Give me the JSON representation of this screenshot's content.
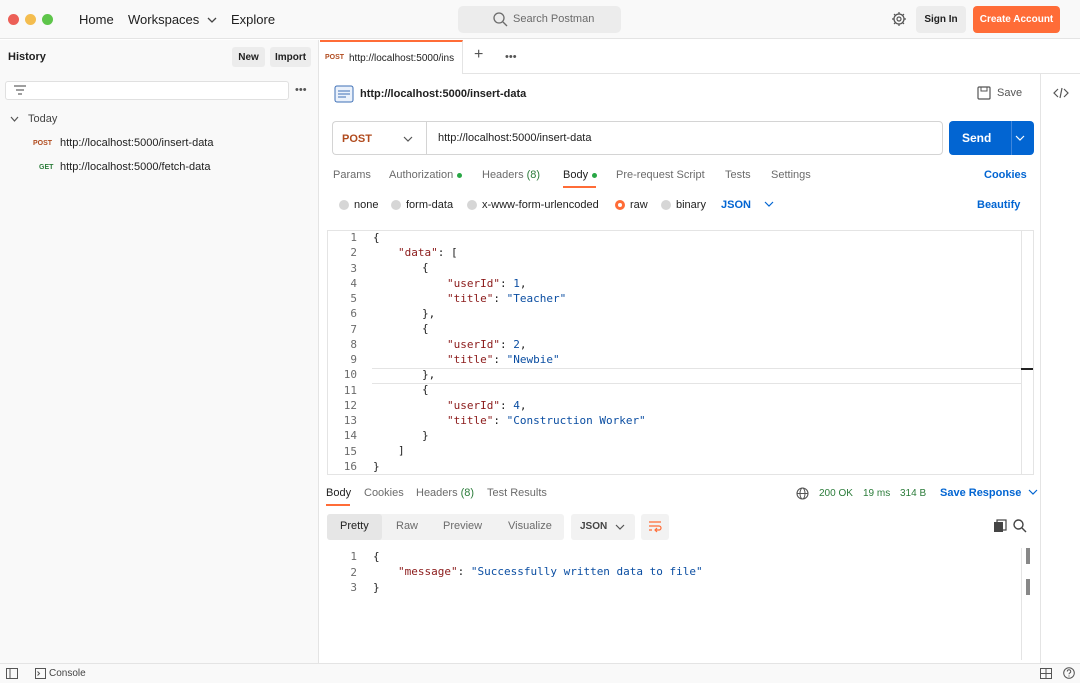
{
  "app": {
    "search_placeholder": "Search Postman",
    "sign_in": "Sign In",
    "create_account": "Create Account"
  },
  "nav": {
    "home": "Home",
    "workspaces": "Workspaces",
    "explore": "Explore"
  },
  "sidebar": {
    "title": "History",
    "new_label": "New",
    "import_label": "Import",
    "group_label": "Today",
    "items": [
      {
        "method": "POST",
        "url": "http://localhost:5000/insert-data",
        "method_color": "#b04a1d"
      },
      {
        "method": "GET",
        "url": "http://localhost:5000/fetch-data",
        "method_color": "#2b7c3a"
      }
    ]
  },
  "tab": {
    "method": "POST",
    "title": "http://localhost:5000/ins"
  },
  "request": {
    "name": "http://localhost:5000/insert-data",
    "save_label": "Save",
    "method": "POST",
    "url": "http://localhost:5000/insert-data",
    "send_label": "Send",
    "tabs": [
      "Params",
      "Authorization",
      "Headers",
      "Body",
      "Pre-request Script",
      "Tests",
      "Settings"
    ],
    "headers_count": "(8)",
    "cookies_label": "Cookies",
    "body_types": [
      "none",
      "form-data",
      "x-www-form-urlencoded",
      "raw",
      "binary"
    ],
    "body_format": "JSON",
    "beautify_label": "Beautify",
    "lines": [
      "1",
      "2",
      "3",
      "4",
      "5",
      "6",
      "7",
      "8",
      "9",
      "10",
      "11",
      "12",
      "13",
      "14",
      "15",
      "16"
    ]
  },
  "response": {
    "tabs": [
      "Body",
      "Cookies",
      "Headers",
      "Test Results"
    ],
    "headers_count": "(8)",
    "status": "200 OK",
    "time": "19 ms",
    "size": "314 B",
    "save_label": "Save Response",
    "formats": [
      "Pretty",
      "Raw",
      "Preview",
      "Visualize"
    ],
    "format_select": "JSON",
    "lines": [
      "1",
      "2",
      "3"
    ],
    "body": {
      "key": "\"message\"",
      "value": "\"Successfully written data to file\""
    }
  },
  "statusbar": {
    "console_label": "Console"
  },
  "colors": {
    "accent": "#ff6c37",
    "send": "#0265d2",
    "post": "#b04a1d",
    "get": "#2b7c3a"
  }
}
